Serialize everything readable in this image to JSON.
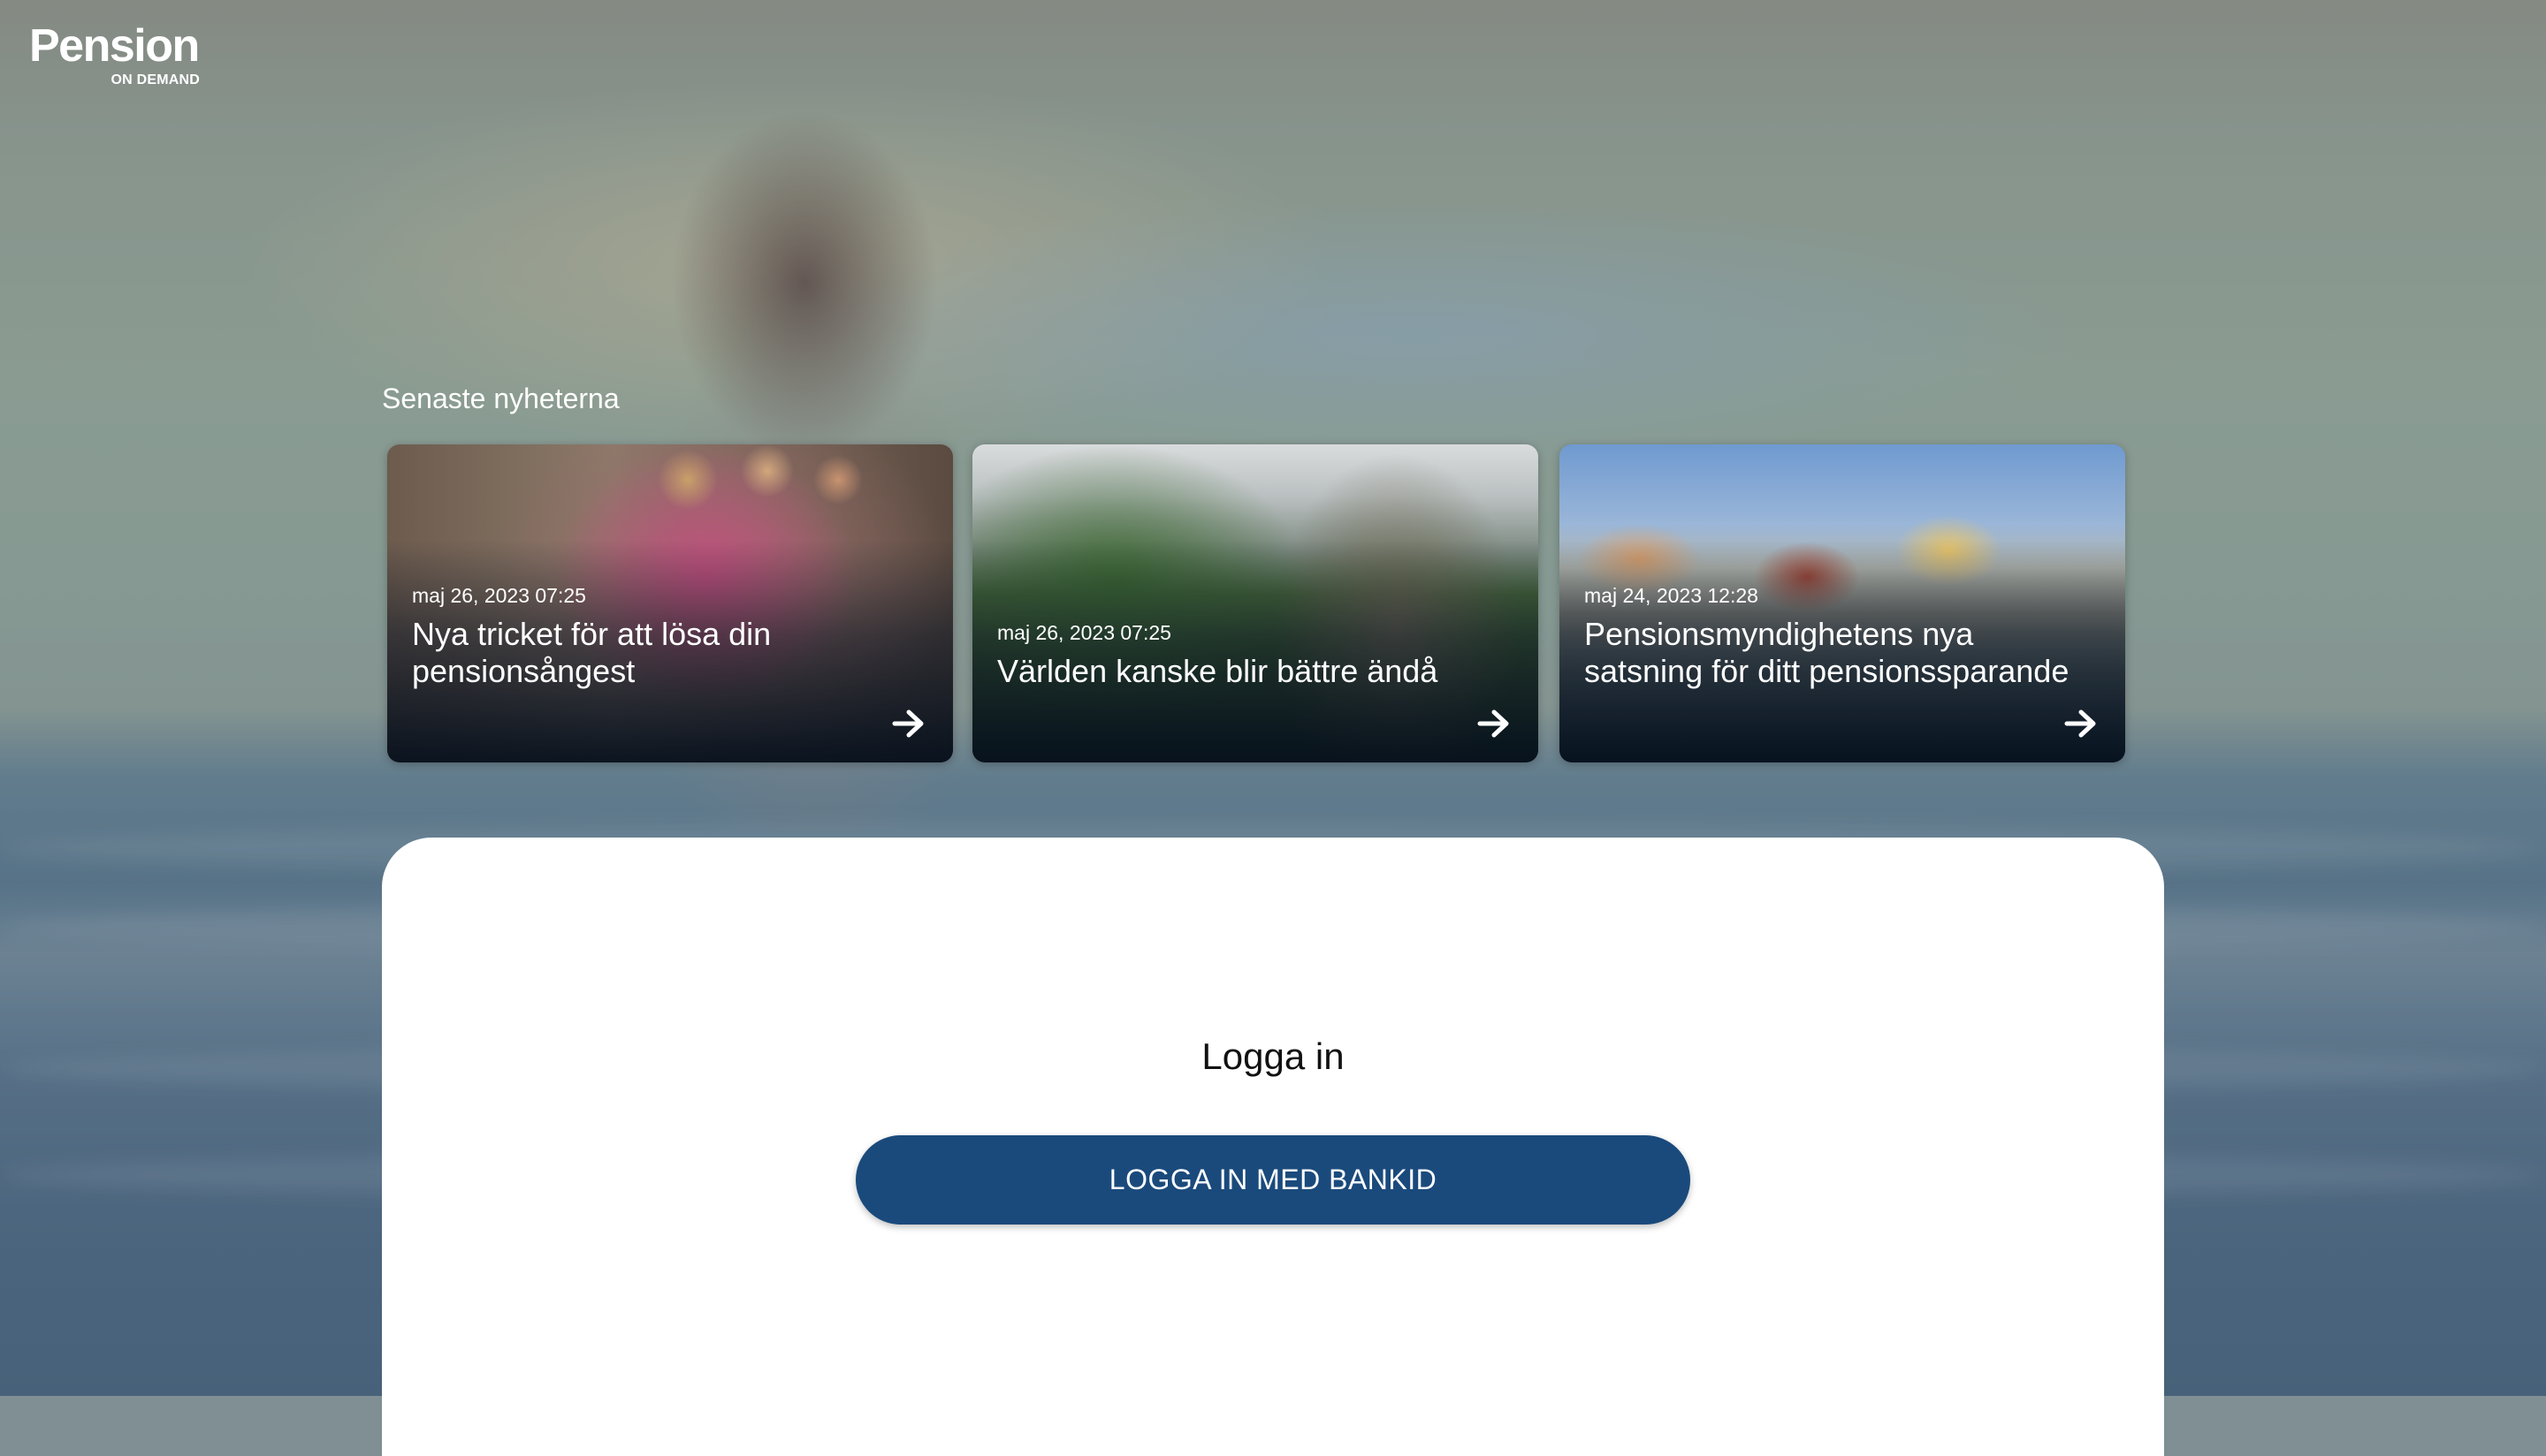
{
  "logo": {
    "brand": "Pension",
    "sub": "ON DEMAND"
  },
  "news": {
    "heading": "Senaste nyheterna",
    "cards": [
      {
        "date": "maj 26, 2023 07:25",
        "title": "Nya tricket för att lösa din pensionsångest"
      },
      {
        "date": "maj 26, 2023 07:25",
        "title": "Världen kanske blir bättre ändå"
      },
      {
        "date": "maj 24, 2023 12:28",
        "title": "Pensionsmyndighetens nya satsning för ditt pensionssparande"
      }
    ]
  },
  "login": {
    "title": "Logga in",
    "button_label": "LOGGA IN MED BANKID"
  },
  "colors": {
    "button": "#1a4a7c",
    "panel": "#ffffff"
  },
  "icons": {
    "card_arrow": "arrow-right-icon"
  }
}
